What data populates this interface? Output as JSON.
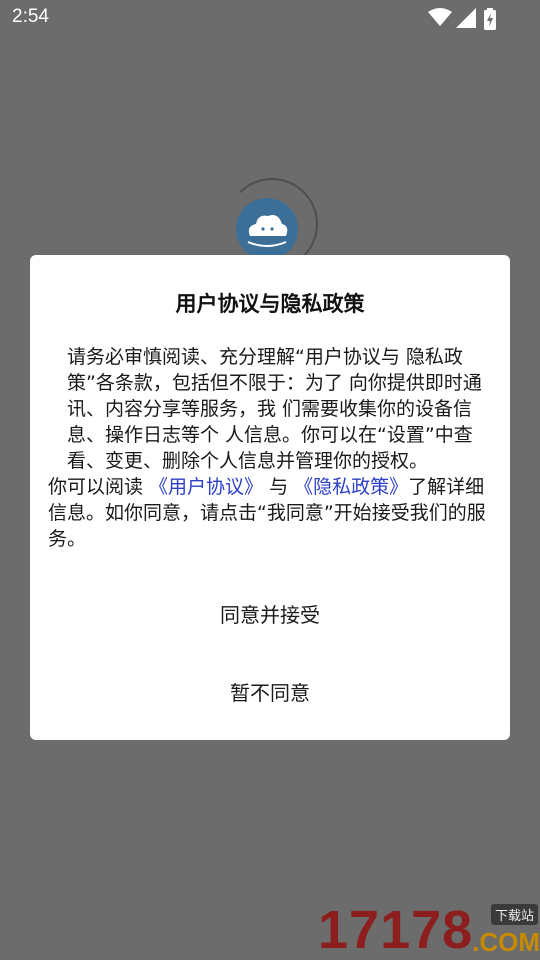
{
  "status_bar": {
    "time": "2:54",
    "icons": [
      "wifi-icon",
      "cell-signal-icon",
      "battery-charging-icon"
    ]
  },
  "splash": {
    "logo_icon": "cloud-logo-icon",
    "logo_color": "#3b6f98"
  },
  "dialog": {
    "title": "用户协议与隐私政策",
    "paragraph1": "请务必审慎阅读、充分理解“用户协议与 隐私政策”各条款，包括但不限于：为了 向你提供即时通讯、内容分享等服务，我 们需要收集你的设备信息、操作日志等个 人信息。你可以在“设置”中查看、变更、删除个人信息并管理你的授权。",
    "p2_prefix": "你可以阅读 ",
    "user_agreement_link": "《用户协议》",
    "p2_and": " 与 ",
    "privacy_policy_link": "《隐私政策》",
    "p2_suffix": "了解详细信息。如你同意，请点击“我同意”开始接受我们的服务。",
    "agree_button": "同意并接受",
    "disagree_button": "暂不同意",
    "link_color": "#2c3fc7"
  },
  "watermark": {
    "digits": "17178",
    "tag": "下载站",
    "domain": ".COM"
  }
}
